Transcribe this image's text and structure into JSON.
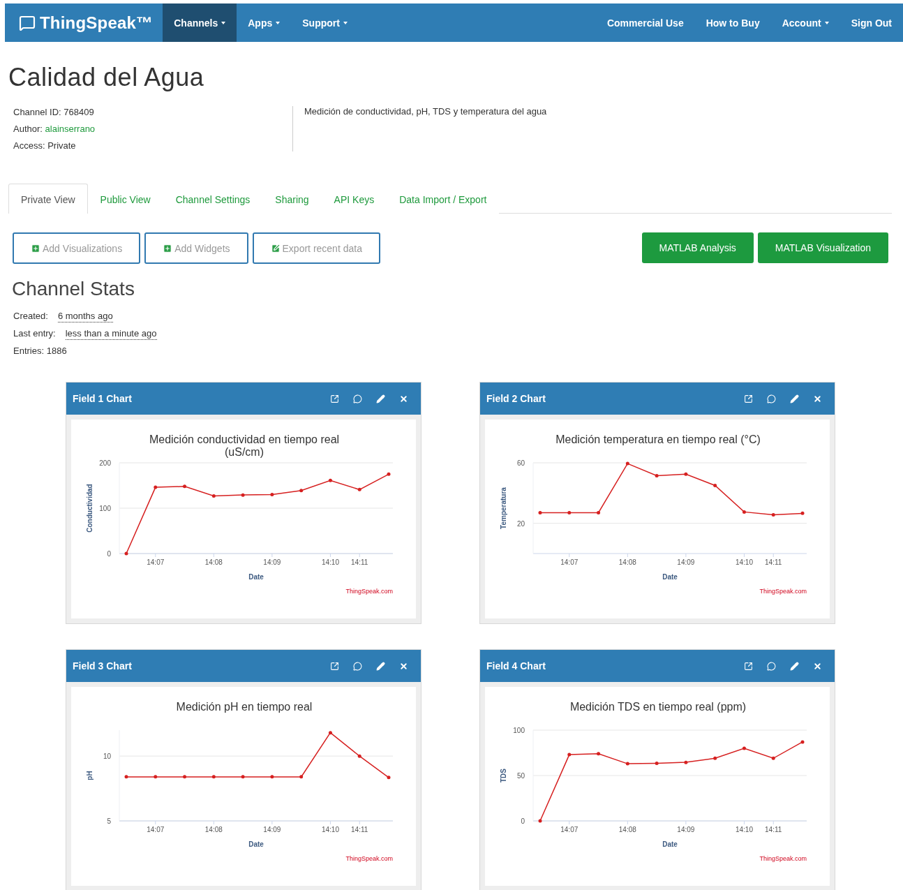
{
  "navbar": {
    "logo": "ThingSpeak™",
    "left": [
      {
        "label": "Channels",
        "dropdown": true,
        "selected": true
      },
      {
        "label": "Apps",
        "dropdown": true,
        "selected": false
      },
      {
        "label": "Support",
        "dropdown": true,
        "selected": false
      }
    ],
    "right": [
      {
        "label": "Commercial Use",
        "dropdown": false,
        "selected": false
      },
      {
        "label": "How to Buy",
        "dropdown": false,
        "selected": false
      },
      {
        "label": "Account",
        "dropdown": true,
        "selected": false
      },
      {
        "label": "Sign Out",
        "dropdown": false,
        "selected": false
      }
    ]
  },
  "title": "Calidad del Agua",
  "info": [
    {
      "label": "Channel ID:",
      "value": "768409",
      "kind": "plain"
    },
    {
      "label": "Author:",
      "value": "alainserrano",
      "kind": "link"
    },
    {
      "label": "Access:",
      "value": "Private",
      "kind": "plain"
    }
  ],
  "description": "Medición de conductividad, pH, TDS y temperatura del agua",
  "tabs": [
    {
      "label": "Private View",
      "selected": true
    },
    {
      "label": "Public View",
      "selected": false
    },
    {
      "label": "Channel Settings",
      "selected": false
    },
    {
      "label": "Sharing",
      "selected": false
    },
    {
      "label": "API Keys",
      "selected": false
    },
    {
      "label": "Data Import / Export",
      "selected": false
    }
  ],
  "actions": [
    {
      "label": "Add Visualizations",
      "kind": "outline"
    },
    {
      "label": "Add Widgets",
      "kind": "outline"
    },
    {
      "label": "Export recent data",
      "kind": "outline"
    },
    {
      "label": "MATLAB Analysis",
      "kind": "solid"
    },
    {
      "label": "MATLAB Visualization",
      "kind": "solid"
    }
  ],
  "stats_title": "Channel Stats",
  "stats": [
    {
      "label": "Created:",
      "value": "6 months ago",
      "kind": "link"
    },
    {
      "label": "Last entry:",
      "value": "less than a minute ago",
      "kind": "link"
    },
    {
      "label": "Entries:",
      "value": "1886",
      "kind": "plain"
    }
  ],
  "panels": [
    {
      "title": "Field 1 Chart",
      "credit": "ThingSpeak.com",
      "chart_data": {
        "type": "line",
        "title": "Medición conductividad en tiempo real\n(uS/cm)",
        "xlabel": "Date",
        "ylabel": "Conductividad",
        "ylim": [
          0,
          200
        ],
        "yticks": [
          0,
          100,
          200
        ],
        "categories": [
          null,
          "14:07",
          null,
          "14:08",
          null,
          "14:09",
          null,
          "14:10",
          "14:11",
          null
        ],
        "values": [
          0,
          146,
          148,
          127,
          129,
          130,
          139,
          161,
          141,
          175
        ]
      }
    },
    {
      "title": "Field 2 Chart",
      "credit": "ThingSpeak.com",
      "chart_data": {
        "type": "line",
        "title": "Medición temperatura en tiempo real (°C)",
        "xlabel": "Date",
        "ylabel": "Temperatura",
        "ylim": [
          0,
          60
        ],
        "yticks": [
          20,
          60
        ],
        "categories": [
          null,
          "14:07",
          null,
          "14:08",
          null,
          "14:09",
          null,
          "14:10",
          "14:11",
          null
        ],
        "values": [
          27,
          27,
          27,
          59.5,
          51.5,
          52.5,
          45,
          27.5,
          25.6,
          26.6
        ]
      }
    },
    {
      "title": "Field 3 Chart",
      "credit": "ThingSpeak.com",
      "chart_data": {
        "type": "line",
        "title": "Medición pH en tiempo real",
        "xlabel": "Date",
        "ylabel": "pH",
        "ylim": [
          5,
          12
        ],
        "yticks": [
          5,
          10
        ],
        "categories": [
          null,
          "14:07",
          null,
          "14:08",
          null,
          "14:09",
          null,
          "14:10",
          "14:11",
          null
        ],
        "values": [
          8.4,
          8.4,
          8.4,
          8.4,
          8.4,
          8.4,
          8.4,
          11.8,
          10,
          8.35
        ]
      }
    },
    {
      "title": "Field 4 Chart",
      "credit": "ThingSpeak.com",
      "chart_data": {
        "type": "line",
        "title": "Medición TDS en tiempo real (ppm)",
        "xlabel": "Date",
        "ylabel": "TDS",
        "ylim": [
          0,
          100
        ],
        "yticks": [
          0,
          50,
          100
        ],
        "categories": [
          null,
          "14:07",
          null,
          "14:08",
          null,
          "14:09",
          null,
          "14:10",
          "14:11",
          null
        ],
        "values": [
          0,
          73,
          74,
          63,
          63.5,
          64.5,
          69,
          80,
          69,
          87
        ]
      }
    }
  ]
}
